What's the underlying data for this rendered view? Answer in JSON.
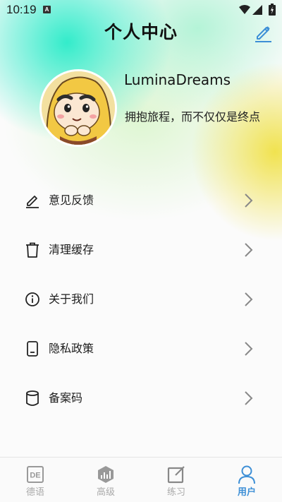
{
  "status_bar": {
    "time": "10:19",
    "a_icon": "A",
    "icons": [
      "wifi-icon",
      "signal-icon",
      "battery-icon"
    ]
  },
  "header": {
    "title": "个人中心",
    "edit_icon": "pencil-icon"
  },
  "profile": {
    "username": "LuminaDreams",
    "motto": "拥抱旅程，而不仅仅是终点"
  },
  "menu": {
    "items": [
      {
        "label": "意见反馈",
        "icon": "edit-icon"
      },
      {
        "label": "清理缓存",
        "icon": "trash-icon"
      },
      {
        "label": "关于我们",
        "icon": "info-icon"
      },
      {
        "label": "隐私政策",
        "icon": "phone-icon"
      },
      {
        "label": "备案码",
        "icon": "database-icon"
      }
    ]
  },
  "bottom_nav": {
    "tabs": [
      {
        "label": "德语",
        "icon": "de-icon",
        "active": false
      },
      {
        "label": "高级",
        "icon": "advanced-icon",
        "active": false
      },
      {
        "label": "练习",
        "icon": "practice-icon",
        "active": false
      },
      {
        "label": "用户",
        "icon": "user-icon",
        "active": true
      }
    ]
  },
  "colors": {
    "accent": "#3d8fd6",
    "inactive": "#aaaaaa",
    "teal_glow": "#28ebc8",
    "yellow_glow": "#f0e146"
  }
}
